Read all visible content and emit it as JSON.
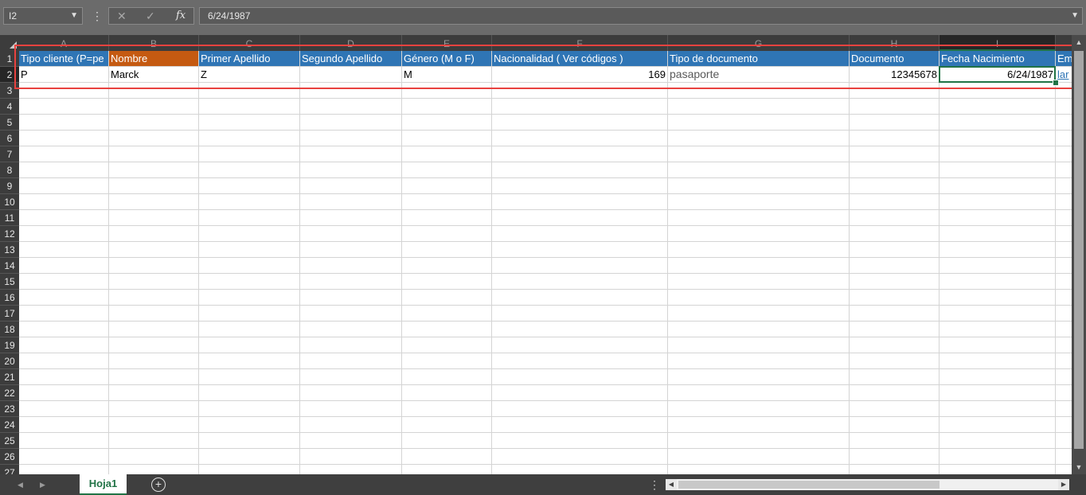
{
  "name_box": {
    "value": "I2",
    "dropdown_icon": "chevron-down-icon"
  },
  "formula_bar": {
    "menu_icon": "more-vertical-icon",
    "cancel_icon": "close-icon",
    "enter_icon": "check-icon",
    "fx_label": "fx",
    "value": "6/24/1987",
    "expand_icon": "chevron-down-icon"
  },
  "columns": [
    "A",
    "B",
    "C",
    "D",
    "E",
    "F",
    "G",
    "H",
    "I"
  ],
  "selected_column": "I",
  "rows": [
    "1",
    "2",
    "3",
    "4",
    "5",
    "6",
    "7",
    "8",
    "9",
    "10",
    "11",
    "12",
    "13",
    "14",
    "15",
    "16",
    "17",
    "18",
    "19",
    "20",
    "21",
    "22",
    "23",
    "24",
    "25",
    "26",
    "27"
  ],
  "selected_row": "2",
  "header_row": {
    "A": "Tipo cliente (P=pe",
    "B": "Nombre",
    "C": "Primer Apellido",
    "D": "Segundo Apellido",
    "E": "Género (M o F)",
    "F": "Nacionalidad ( Ver códigos )",
    "G": "Tipo de documento",
    "H": "Documento",
    "I": "Fecha Nacimiento",
    "J": "Em"
  },
  "data_row": {
    "A": "P",
    "B": "Marck",
    "C": "Z",
    "D": "",
    "E": "M",
    "F": "169",
    "G": "pasaporte",
    "H": "12345678",
    "I": "6/24/1987",
    "J": "lar"
  },
  "colors": {
    "header_blue": "#2f75b5",
    "header_orange": "#c55a11",
    "selection_green": "#217346",
    "annotation_red": "#e8423f"
  },
  "sheet_bar": {
    "prev_icon": "triangle-left-icon",
    "next_icon": "triangle-right-icon",
    "tabs": [
      "Hoja1"
    ],
    "active_tab": "Hoja1",
    "add_icon": "plus-circle-icon"
  }
}
